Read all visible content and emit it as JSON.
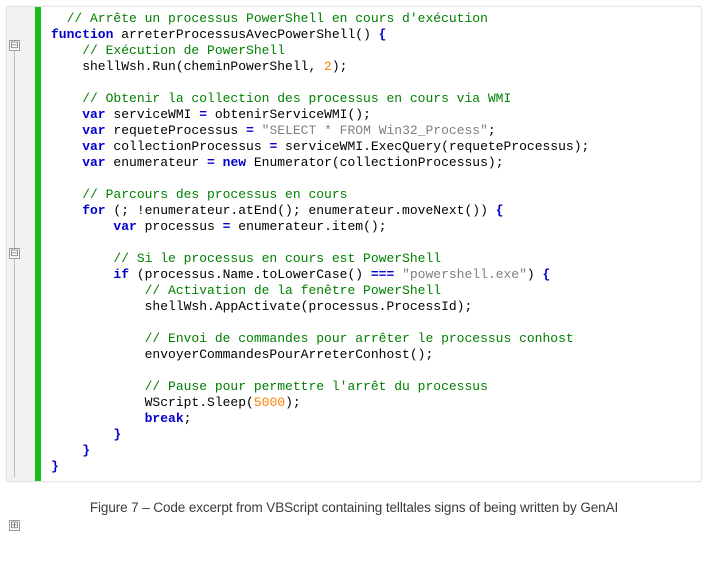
{
  "caption": "Figure 7 – Code excerpt from VBScript containing telltales signs of being written by GenAI",
  "code": {
    "lines": [
      [
        {
          "cls": "c-comment",
          "pad": 2,
          "t": "// Arrête un processus PowerShell en cours d'exécution"
        }
      ],
      [
        {
          "cls": "c-keyword",
          "pad": 0,
          "t": "function"
        },
        {
          "cls": "",
          "t": " arreterProcessusAvecPowerShell() "
        },
        {
          "cls": "c-keyword",
          "t": "{"
        }
      ],
      [
        {
          "cls": "c-comment",
          "pad": 4,
          "t": "// Exécution de PowerShell"
        }
      ],
      [
        {
          "cls": "",
          "pad": 4,
          "t": "shellWsh.Run(cheminPowerShell, "
        },
        {
          "cls": "c-number",
          "t": "2"
        },
        {
          "cls": "",
          "t": ");"
        }
      ],
      [
        {
          "cls": "",
          "t": " "
        }
      ],
      [
        {
          "cls": "c-comment",
          "pad": 4,
          "t": "// Obtenir la collection des processus en cours via WMI"
        }
      ],
      [
        {
          "cls": "c-keyword",
          "pad": 4,
          "t": "var"
        },
        {
          "cls": "",
          "t": " serviceWMI "
        },
        {
          "cls": "c-keyword",
          "t": "="
        },
        {
          "cls": "",
          "t": " obtenirServiceWMI();"
        }
      ],
      [
        {
          "cls": "c-keyword",
          "pad": 4,
          "t": "var"
        },
        {
          "cls": "",
          "t": " requeteProcessus "
        },
        {
          "cls": "c-keyword",
          "t": "="
        },
        {
          "cls": "",
          "t": " "
        },
        {
          "cls": "c-string",
          "t": "\"SELECT * FROM Win32_Process\""
        },
        {
          "cls": "",
          "t": ";"
        }
      ],
      [
        {
          "cls": "c-keyword",
          "pad": 4,
          "t": "var"
        },
        {
          "cls": "",
          "t": " collectionProcessus "
        },
        {
          "cls": "c-keyword",
          "t": "="
        },
        {
          "cls": "",
          "t": " serviceWMI.ExecQuery(requeteProcessus);"
        }
      ],
      [
        {
          "cls": "c-keyword",
          "pad": 4,
          "t": "var"
        },
        {
          "cls": "",
          "t": " enumerateur "
        },
        {
          "cls": "c-keyword",
          "t": "="
        },
        {
          "cls": "",
          "t": " "
        },
        {
          "cls": "c-keyword",
          "t": "new"
        },
        {
          "cls": "",
          "t": " Enumerator(collectionProcessus);"
        }
      ],
      [
        {
          "cls": "",
          "t": " "
        }
      ],
      [
        {
          "cls": "c-comment",
          "pad": 4,
          "t": "// Parcours des processus en cours"
        }
      ],
      [
        {
          "cls": "c-keyword",
          "pad": 4,
          "t": "for"
        },
        {
          "cls": "",
          "t": " (; !enumerateur.atEnd(); enumerateur.moveNext()) "
        },
        {
          "cls": "c-keyword",
          "t": "{"
        }
      ],
      [
        {
          "cls": "c-keyword",
          "pad": 8,
          "t": "var"
        },
        {
          "cls": "",
          "t": " processus "
        },
        {
          "cls": "c-keyword",
          "t": "="
        },
        {
          "cls": "",
          "t": " enumerateur.item();"
        }
      ],
      [
        {
          "cls": "",
          "t": " "
        }
      ],
      [
        {
          "cls": "c-comment",
          "pad": 8,
          "t": "// Si le processus en cours est PowerShell"
        }
      ],
      [
        {
          "cls": "c-keyword",
          "pad": 8,
          "t": "if"
        },
        {
          "cls": "",
          "t": " (processus.Name.toLowerCase() "
        },
        {
          "cls": "c-keyword",
          "t": "==="
        },
        {
          "cls": "",
          "t": " "
        },
        {
          "cls": "c-string",
          "t": "\"powershell.exe\""
        },
        {
          "cls": "",
          "t": ") "
        },
        {
          "cls": "c-keyword",
          "t": "{"
        }
      ],
      [
        {
          "cls": "c-comment",
          "pad": 12,
          "t": "// Activation de la fenêtre PowerShell"
        }
      ],
      [
        {
          "cls": "",
          "pad": 12,
          "t": "shellWsh.AppActivate(processus.ProcessId);"
        }
      ],
      [
        {
          "cls": "",
          "t": " "
        }
      ],
      [
        {
          "cls": "c-comment",
          "pad": 12,
          "t": "// Envoi de commandes pour arrêter le processus conhost"
        }
      ],
      [
        {
          "cls": "",
          "pad": 12,
          "t": "envoyerCommandesPourArreterConhost();"
        }
      ],
      [
        {
          "cls": "",
          "t": " "
        }
      ],
      [
        {
          "cls": "c-comment",
          "pad": 12,
          "t": "// Pause pour permettre l'arrêt du processus"
        }
      ],
      [
        {
          "cls": "",
          "pad": 12,
          "t": "WScript.Sleep("
        },
        {
          "cls": "c-number",
          "t": "5000"
        },
        {
          "cls": "",
          "t": ");"
        }
      ],
      [
        {
          "cls": "c-keyword",
          "pad": 12,
          "t": "break"
        },
        {
          "cls": "",
          "t": ";"
        }
      ],
      [
        {
          "cls": "c-keyword",
          "pad": 8,
          "t": "}"
        }
      ],
      [
        {
          "cls": "c-keyword",
          "pad": 4,
          "t": "}"
        }
      ],
      [
        {
          "cls": "c-keyword",
          "pad": 0,
          "t": "}"
        }
      ]
    ]
  },
  "fold_icons": [
    "⊟",
    "⊟",
    "⊞"
  ]
}
